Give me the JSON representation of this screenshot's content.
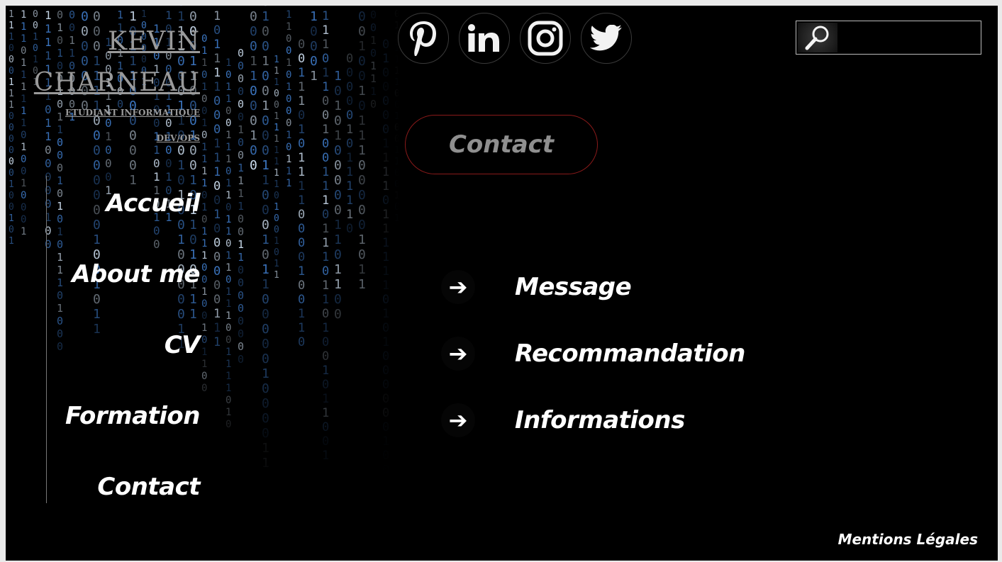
{
  "brand": {
    "first_name": "KEVIN",
    "last_name": "CHARNEAU",
    "subtitle": "ETUDIANT INFORMATIQUE",
    "subtitle2": "DEV/OPS"
  },
  "nav": {
    "items": [
      {
        "label": "Accueil"
      },
      {
        "label": "About me"
      },
      {
        "label": "CV"
      },
      {
        "label": "Formation"
      },
      {
        "label": "Contact"
      }
    ]
  },
  "social": {
    "icons": [
      "pinterest-icon",
      "linkedin-icon",
      "instagram-icon",
      "twitter-icon"
    ]
  },
  "search": {
    "placeholder": "",
    "value": ""
  },
  "main": {
    "section_button": "Contact",
    "links": [
      {
        "label": "Message"
      },
      {
        "label": "Recommandation"
      },
      {
        "label": "Informations"
      }
    ],
    "arrow_glyph": "➔"
  },
  "footer": {
    "mentions": "Mentions Légales"
  },
  "colors": {
    "background": "#000000",
    "accent_border": "#8a1a1a",
    "matrix_blue": "#3d78c4"
  }
}
